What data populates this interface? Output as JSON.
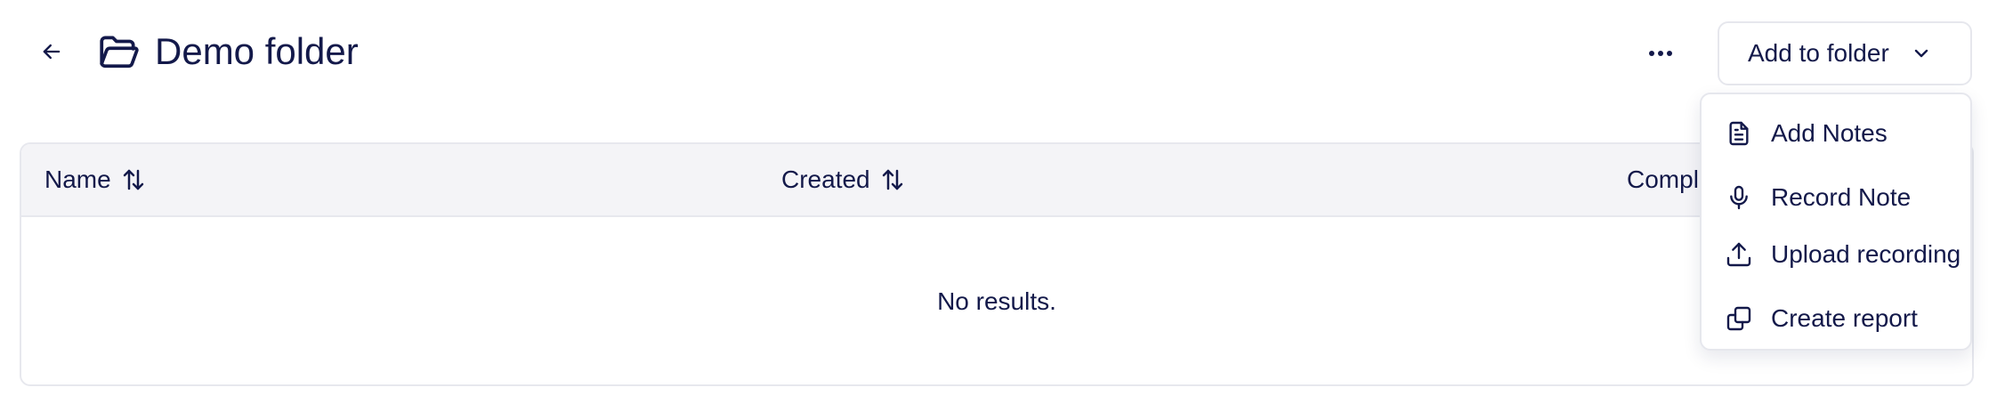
{
  "header": {
    "back_icon": "arrow-left-icon",
    "folder_icon": "folder-open-icon",
    "title": "Demo folder",
    "more_icon": "ellipsis-icon",
    "add_to_folder_label": "Add to folder",
    "chevron_icon": "chevron-down-icon"
  },
  "table": {
    "columns": [
      {
        "label": "Name",
        "sort_icon": "sort-arrows-icon"
      },
      {
        "label": "Created",
        "sort_icon": "sort-arrows-icon"
      },
      {
        "label": "Compl"
      }
    ],
    "empty_text": "No results."
  },
  "menu": {
    "items": [
      {
        "label": "Add Notes",
        "icon": "document-icon"
      },
      {
        "label": "Record Note",
        "icon": "microphone-icon"
      },
      {
        "label": "Upload recording",
        "icon": "upload-icon"
      },
      {
        "label": "Create report",
        "icon": "copy-icon"
      }
    ]
  },
  "colors": {
    "text": "#13194a",
    "header_bg": "#f4f4f7",
    "border": "#e7e8ee"
  }
}
